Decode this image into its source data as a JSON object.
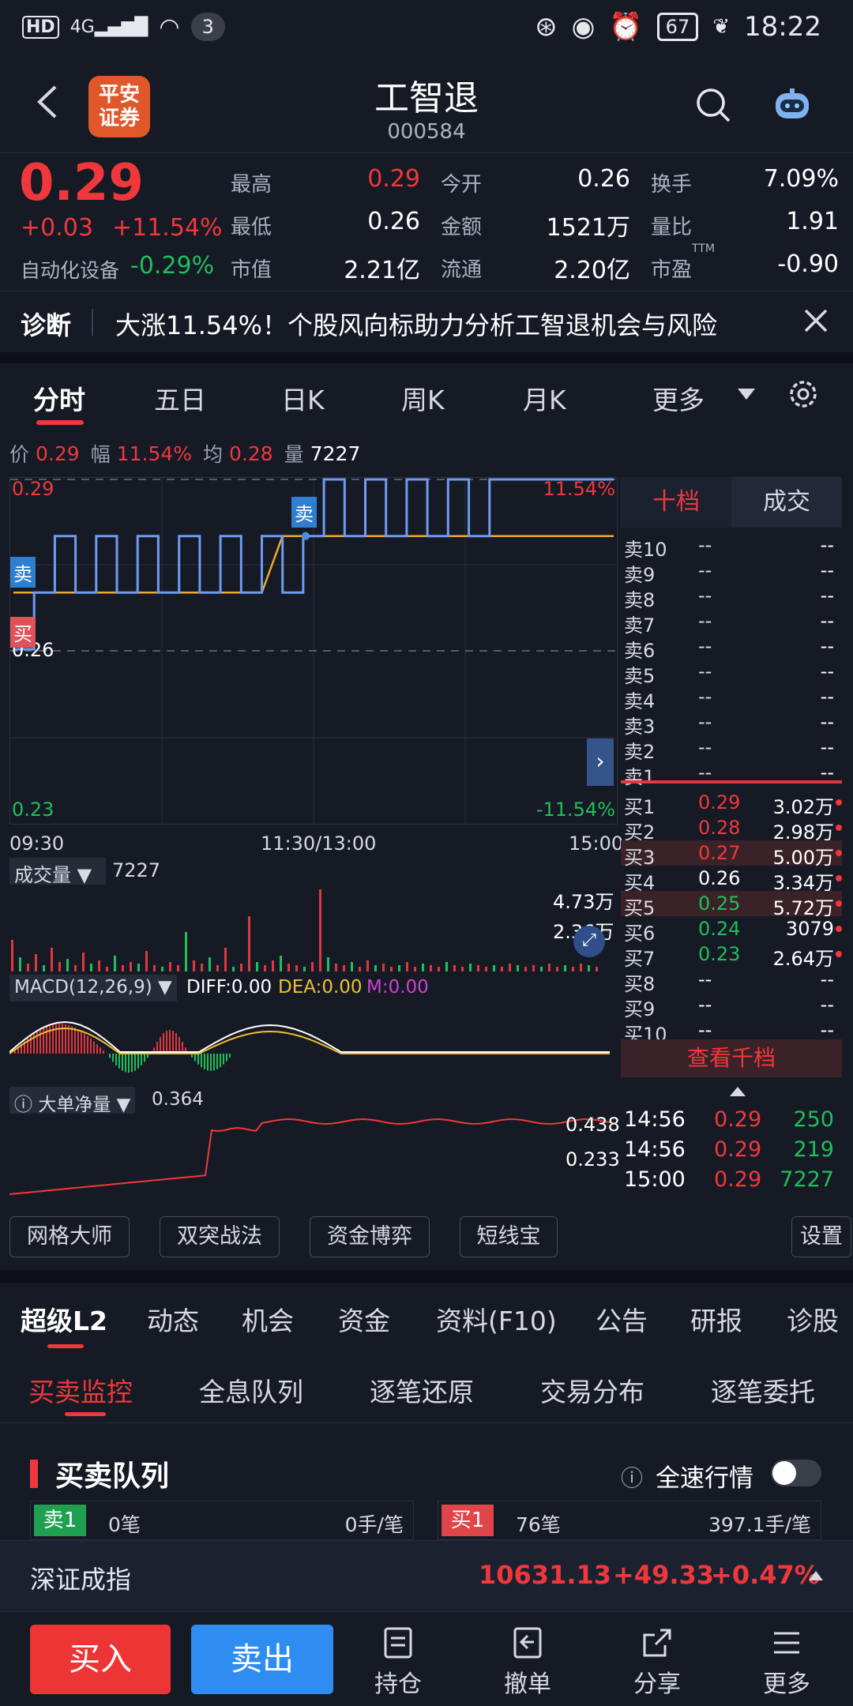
{
  "status": {
    "network": "4G",
    "hd": "HD",
    "wifi_badge": "3",
    "battery": "67",
    "time": "18:22"
  },
  "header": {
    "title": "工智退",
    "code": "000584",
    "logo_line1": "平安",
    "logo_line2": "证券"
  },
  "quote": {
    "price": "0.29",
    "change": "+0.03",
    "change_pct": "+11.54%",
    "industry": "自动化设备",
    "industry_pct": "-0.29%",
    "stats": [
      {
        "label": "最高",
        "value": "0.29",
        "color": "red"
      },
      {
        "label": "今开",
        "value": "0.26",
        "color": "white"
      },
      {
        "label": "换手",
        "value": "7.09%",
        "color": "white"
      },
      {
        "label": "最低",
        "value": "0.26",
        "color": "white"
      },
      {
        "label": "金额",
        "value": "1521万",
        "color": "white"
      },
      {
        "label": "量比",
        "value": "1.91",
        "color": "white"
      },
      {
        "label": "市值",
        "value": "2.21亿",
        "color": "white"
      },
      {
        "label": "流通",
        "value": "2.20亿",
        "color": "white"
      },
      {
        "label": "市盈",
        "value": "-0.90",
        "color": "white",
        "sup": "TTM"
      }
    ]
  },
  "diag": {
    "label": "诊断",
    "text": "大涨11.54%！个股风向标助力分析工智退机会与风险"
  },
  "period_tabs": [
    "分时",
    "五日",
    "日K",
    "周K",
    "月K",
    "更多"
  ],
  "info": {
    "price_label": "价",
    "price": "0.29",
    "amp_label": "幅",
    "amp": "11.54%",
    "avg_label": "均",
    "avg": "0.28",
    "vol_label": "量",
    "vol": "7227"
  },
  "chart_labels": {
    "top_price": "0.29",
    "top_pct": "11.54%",
    "mid_price": "0.26",
    "low_price": "0.23",
    "low_pct": "-11.54%",
    "t_start": "09:30",
    "t_mid": "11:30/13:00",
    "t_end": "15:00",
    "sell_marker": "卖",
    "buy_marker": "买",
    "vol_title": "成交量",
    "vol_value": "7227",
    "vol_max": "4.73万",
    "vol_mid": "2.36万",
    "macd_title": "MACD(12,26,9)",
    "diff": "DIFF:0.00",
    "dea": "DEA:0.00",
    "m": "M:0.00",
    "big_title": "大单净量",
    "big_value": "0.364",
    "big_top": "0.438",
    "big_mid": "0.233"
  },
  "chart_data": {
    "type": "line",
    "title": "",
    "x_range": [
      "09:30",
      "15:00"
    ],
    "ylim": [
      0.23,
      0.29
    ],
    "series": [
      {
        "name": "价",
        "values": [
          0.26,
          0.27,
          0.28,
          0.27,
          0.28,
          0.27,
          0.28,
          0.27,
          0.28,
          0.27,
          0.28,
          0.27,
          0.28,
          0.27,
          0.28,
          0.29,
          0.28,
          0.29,
          0.28,
          0.29,
          0.28,
          0.29,
          0.28,
          0.29,
          0.29,
          0.29,
          0.29,
          0.29,
          0.29,
          0.29
        ]
      },
      {
        "name": "均",
        "values": [
          0.27,
          0.27,
          0.27,
          0.27,
          0.27,
          0.27,
          0.27,
          0.27,
          0.27,
          0.27,
          0.27,
          0.27,
          0.27,
          0.28,
          0.28,
          0.28,
          0.28,
          0.28,
          0.28,
          0.28,
          0.28,
          0.28,
          0.28,
          0.28,
          0.28,
          0.28,
          0.28,
          0.28,
          0.28,
          0.28
        ]
      }
    ]
  },
  "orderbook": {
    "tabs": [
      "十档",
      "成交"
    ],
    "sells": [
      {
        "name": "卖10",
        "price": "--",
        "vol": "--"
      },
      {
        "name": "卖9",
        "price": "--",
        "vol": "--"
      },
      {
        "name": "卖8",
        "price": "--",
        "vol": "--"
      },
      {
        "name": "卖7",
        "price": "--",
        "vol": "--"
      },
      {
        "name": "卖6",
        "price": "--",
        "vol": "--"
      },
      {
        "name": "卖5",
        "price": "--",
        "vol": "--"
      },
      {
        "name": "卖4",
        "price": "--",
        "vol": "--"
      },
      {
        "name": "卖3",
        "price": "--",
        "vol": "--"
      },
      {
        "name": "卖2",
        "price": "--",
        "vol": "--"
      },
      {
        "name": "卖1",
        "price": "--",
        "vol": "--"
      }
    ],
    "buys": [
      {
        "name": "买1",
        "price": "0.29",
        "vol": "3.02万",
        "color": "red"
      },
      {
        "name": "买2",
        "price": "0.28",
        "vol": "2.98万",
        "color": "red"
      },
      {
        "name": "买3",
        "price": "0.27",
        "vol": "5.00万",
        "color": "red"
      },
      {
        "name": "买4",
        "price": "0.26",
        "vol": "3.34万",
        "color": "white"
      },
      {
        "name": "买5",
        "price": "0.25",
        "vol": "5.72万",
        "color": "green"
      },
      {
        "name": "买6",
        "price": "0.24",
        "vol": "3079",
        "color": "green"
      },
      {
        "name": "买7",
        "price": "0.23",
        "vol": "2.64万",
        "color": "green"
      },
      {
        "name": "买8",
        "price": "--",
        "vol": "--",
        "color": "white"
      },
      {
        "name": "买9",
        "price": "--",
        "vol": "--",
        "color": "white"
      },
      {
        "name": "买10",
        "price": "--",
        "vol": "--",
        "color": "white"
      }
    ],
    "view_all": "查看千档",
    "trades": [
      {
        "time": "14:56",
        "price": "0.29",
        "vol": "250"
      },
      {
        "time": "14:56",
        "price": "0.29",
        "vol": "219"
      },
      {
        "time": "15:00",
        "price": "0.29",
        "vol": "7227"
      }
    ]
  },
  "tools": [
    "网格大师",
    "双突战法",
    "资金博弈",
    "短线宝",
    "设置"
  ],
  "l2_tabs": [
    "超级L2",
    "动态",
    "机会",
    "资金",
    "资料(F10)",
    "公告",
    "研报",
    "诊股"
  ],
  "sub_tabs": [
    "买卖监控",
    "全息队列",
    "逐笔还原",
    "交易分布",
    "逐笔委托"
  ],
  "queue": {
    "title": "买卖队列",
    "fast_label": "全速行情",
    "sell_tag": "卖1",
    "sell_count": "0笔",
    "sell_avg": "0手/笔",
    "buy_tag": "买1",
    "buy_count": "76笔",
    "buy_avg": "397.1手/笔"
  },
  "index": {
    "name": "深证成指",
    "value": "10631.13",
    "change": "+49.33",
    "pct": "+0.47%"
  },
  "bottom": {
    "buy": "买入",
    "sell": "卖出",
    "items": [
      "持仓",
      "撤单",
      "分享",
      "更多"
    ]
  },
  "colors": {
    "red": "#f0383c",
    "green": "#1fbf5a",
    "blue": "#2f8cf0",
    "bg": "#161a25"
  }
}
